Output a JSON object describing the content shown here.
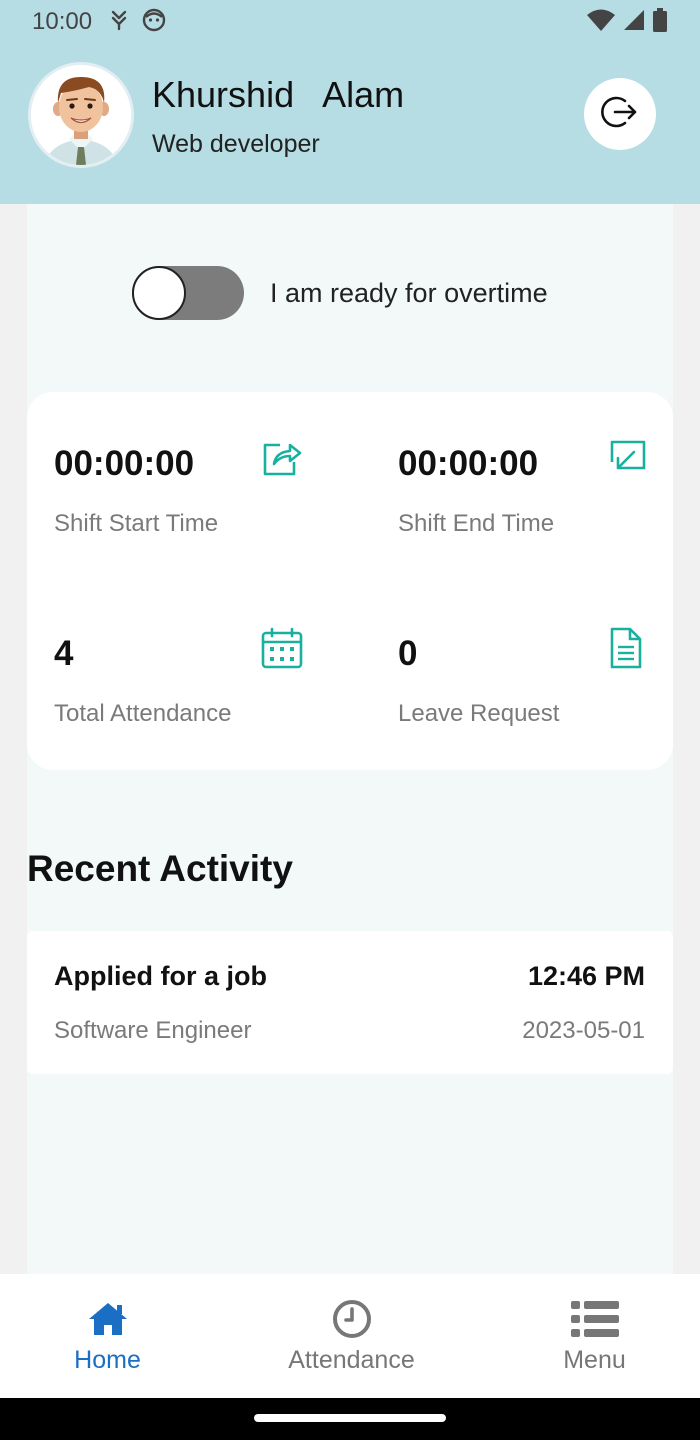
{
  "status_bar": {
    "time": "10:00",
    "left_icons": [
      "data-saver-icon",
      "face-icon"
    ],
    "right_icons": [
      "wifi-icon",
      "signal-icon",
      "battery-icon"
    ]
  },
  "header": {
    "first_name": "Khurshid",
    "last_name": "Alam",
    "role": "Web developer",
    "logout_icon": "logout-icon"
  },
  "overtime": {
    "label": "I am ready for overtime",
    "enabled": false
  },
  "stats": [
    {
      "value": "00:00:00",
      "label": "Shift Start Time",
      "icon": "share-out-icon"
    },
    {
      "value": "00:00:00",
      "label": "Shift End Time",
      "icon": "share-in-icon"
    },
    {
      "value": "4",
      "label": "Total Attendance",
      "icon": "calendar-icon"
    },
    {
      "value": "0",
      "label": "Leave Request",
      "icon": "document-icon"
    }
  ],
  "recent": {
    "title": "Recent Activity",
    "items": [
      {
        "title": "Applied for a job",
        "subtitle": "Software Engineer",
        "time": "12:46 PM",
        "date": "2023-05-01"
      }
    ]
  },
  "nav": {
    "items": [
      {
        "label": "Home",
        "icon": "home-icon",
        "active": true
      },
      {
        "label": "Attendance",
        "icon": "clock-icon",
        "active": false
      },
      {
        "label": "Menu",
        "icon": "list-menu-icon",
        "active": false
      }
    ]
  },
  "colors": {
    "header_bg": "#b6dce4",
    "accent_teal": "#1ab0a0",
    "nav_active": "#1a6fc4",
    "page_bg": "#f3f9f9"
  }
}
